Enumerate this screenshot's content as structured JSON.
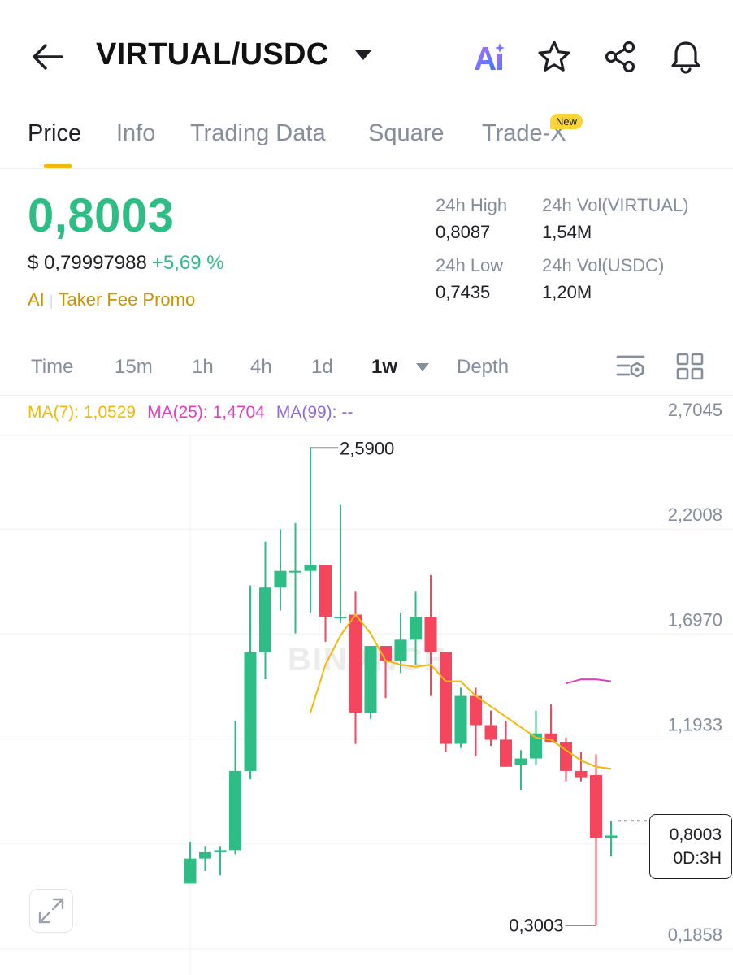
{
  "header": {
    "pair": "VIRTUAL/USDC",
    "icons": [
      "back-arrow-icon",
      "dropdown-caret-icon",
      "ai-icon",
      "star-icon",
      "share-icon",
      "bell-icon"
    ],
    "ai_label": "Ai"
  },
  "tabs": [
    {
      "label": "Price",
      "active": true
    },
    {
      "label": "Info"
    },
    {
      "label": "Trading Data"
    },
    {
      "label": "Square"
    },
    {
      "label": "Trade-X",
      "badge": "New"
    }
  ],
  "ticker": {
    "last_price": "0,8003",
    "usd_price": "$ 0,79997988",
    "change": "+5,69 %",
    "tag1": "AI",
    "tag2": "Taker Fee Promo",
    "high_label": "24h High",
    "high_value": "0,8087",
    "low_label": "24h Low",
    "low_value": "0,7435",
    "vol_base_label": "24h Vol(VIRTUAL)",
    "vol_base_value": "1,54M",
    "vol_quote_label": "24h Vol(USDC)",
    "vol_quote_value": "1,20M"
  },
  "intervals": {
    "time": "Time",
    "m15": "15m",
    "h1": "1h",
    "h4": "4h",
    "d1": "1d",
    "w1": "1w",
    "depth": "Depth",
    "icons": [
      "chart-settings-icon",
      "grid-layout-icon"
    ]
  },
  "ma": {
    "ma7": "MA(7): 1,0529",
    "ma25": "MA(25): 1,4704",
    "ma99": "MA(99): --"
  },
  "colors": {
    "up": "#2ebd85",
    "down": "#f6465d",
    "ma7": "#f0b90b",
    "ma25": "#e040c0",
    "ma99": "#8e6bd6",
    "accent": "#f0b90b"
  },
  "chart_data": {
    "type": "candlestick",
    "interval": "1w",
    "y_ticks": [
      "2,7045",
      "2,2008",
      "1,6970",
      "1,1933",
      "0,6895",
      "0,1858"
    ],
    "y_tick_values": [
      2.7045,
      2.2008,
      1.697,
      1.1933,
      0.6895,
      0.1858
    ],
    "ylim": [
      0.1858,
      2.7045
    ],
    "grid": true,
    "watermark": "BINANCE",
    "max_label": "2,5900",
    "min_label": "0,3003",
    "current_price": "0,8003",
    "countdown": "0D:3H",
    "candles": [
      {
        "o": 0.5,
        "h": 0.7,
        "l": 0.5,
        "c": 0.62
      },
      {
        "o": 0.62,
        "h": 0.68,
        "l": 0.56,
        "c": 0.65
      },
      {
        "o": 0.65,
        "h": 0.68,
        "l": 0.54,
        "c": 0.66
      },
      {
        "o": 0.66,
        "h": 1.28,
        "l": 0.64,
        "c": 1.04
      },
      {
        "o": 1.04,
        "h": 1.93,
        "l": 1.0,
        "c": 1.61
      },
      {
        "o": 1.61,
        "h": 2.14,
        "l": 1.48,
        "c": 1.92
      },
      {
        "o": 1.92,
        "h": 2.2,
        "l": 1.81,
        "c": 2.0
      },
      {
        "o": 2.0,
        "h": 2.23,
        "l": 1.7,
        "c": 2.0
      },
      {
        "o": 2.0,
        "h": 2.59,
        "l": 1.8,
        "c": 2.03
      },
      {
        "o": 2.03,
        "h": 2.03,
        "l": 1.66,
        "c": 1.78
      },
      {
        "o": 1.78,
        "h": 2.32,
        "l": 1.75,
        "c": 1.78
      },
      {
        "o": 1.79,
        "h": 1.9,
        "l": 1.17,
        "c": 1.32
      },
      {
        "o": 1.32,
        "h": 1.62,
        "l": 1.29,
        "c": 1.64
      },
      {
        "o": 1.64,
        "h": 1.64,
        "l": 1.39,
        "c": 1.57
      },
      {
        "o": 1.57,
        "h": 1.8,
        "l": 1.51,
        "c": 1.67
      },
      {
        "o": 1.67,
        "h": 1.9,
        "l": 1.55,
        "c": 1.78
      },
      {
        "o": 1.78,
        "h": 1.98,
        "l": 1.4,
        "c": 1.61
      },
      {
        "o": 1.61,
        "h": 1.61,
        "l": 1.13,
        "c": 1.17
      },
      {
        "o": 1.17,
        "h": 1.44,
        "l": 1.15,
        "c": 1.4
      },
      {
        "o": 1.4,
        "h": 1.44,
        "l": 1.11,
        "c": 1.26
      },
      {
        "o": 1.26,
        "h": 1.33,
        "l": 1.16,
        "c": 1.19
      },
      {
        "o": 1.19,
        "h": 1.28,
        "l": 1.06,
        "c": 1.06
      },
      {
        "o": 1.07,
        "h": 1.14,
        "l": 0.95,
        "c": 1.1
      },
      {
        "o": 1.1,
        "h": 1.33,
        "l": 1.07,
        "c": 1.22
      },
      {
        "o": 1.22,
        "h": 1.36,
        "l": 1.18,
        "c": 1.18
      },
      {
        "o": 1.18,
        "h": 1.2,
        "l": 0.99,
        "c": 1.04
      },
      {
        "o": 1.04,
        "h": 1.13,
        "l": 0.99,
        "c": 1.01
      },
      {
        "o": 1.02,
        "h": 1.12,
        "l": 0.3,
        "c": 0.72
      },
      {
        "o": 0.72,
        "h": 0.8,
        "l": 0.63,
        "c": 0.73
      }
    ],
    "ma7_values": [
      null,
      null,
      null,
      null,
      null,
      null,
      null,
      null,
      1.32,
      1.55,
      1.69,
      1.79,
      1.7,
      1.57,
      1.55,
      1.54,
      1.55,
      1.47,
      1.47,
      1.4,
      1.35,
      1.3,
      1.25,
      1.2,
      1.19,
      1.14,
      1.09,
      1.06,
      1.05
    ],
    "ma25_values": [
      null,
      null,
      null,
      null,
      null,
      null,
      null,
      null,
      null,
      null,
      null,
      null,
      null,
      null,
      null,
      null,
      null,
      null,
      null,
      null,
      null,
      null,
      null,
      null,
      null,
      1.46,
      1.48,
      1.48,
      1.47
    ]
  }
}
